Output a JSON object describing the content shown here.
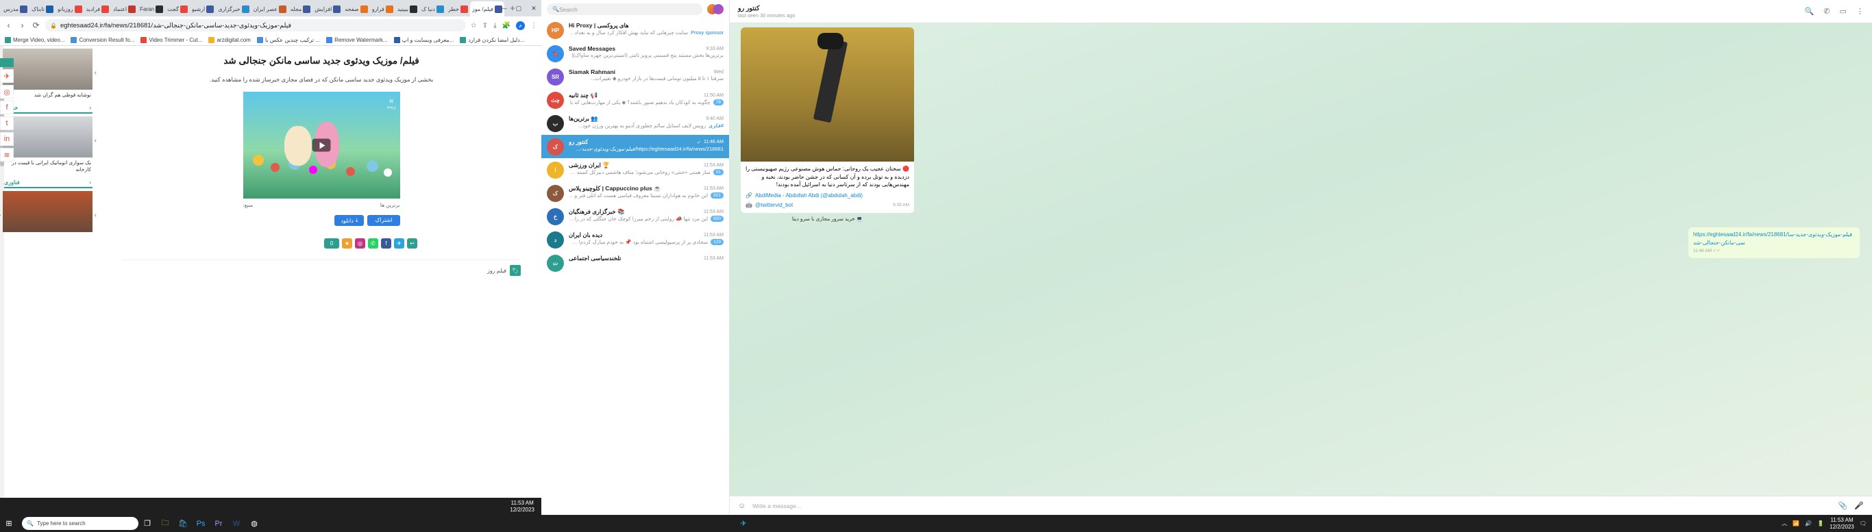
{
  "browser": {
    "tabs": [
      {
        "label": "مدرس",
        "color": "#3d5a9e"
      },
      {
        "label": "تابناک",
        "color": "#1b5fa8"
      },
      {
        "label": "روزیاتو",
        "color": "#e8453c"
      },
      {
        "label": "فرادید",
        "color": "#e8453c"
      },
      {
        "label": "اعتماد",
        "color": "#c0392b"
      },
      {
        "label": "Faran",
        "color": "#2c2c2c"
      },
      {
        "label": "گجت",
        "color": "#e8453c"
      },
      {
        "label": "آرشیو",
        "color": "#3d5a9e"
      },
      {
        "label": "خبرگزاری",
        "color": "#2b8ccc"
      },
      {
        "label": "عصر ایران",
        "color": "#c75b2a"
      },
      {
        "label": "مجله",
        "color": "#3d5a9e"
      },
      {
        "label": "افزایش",
        "color": "#3d5a9e"
      },
      {
        "label": "صفحه",
        "color": "#e8731c"
      },
      {
        "label": "قرارو",
        "color": "#e8731c"
      },
      {
        "label": "ببینید",
        "color": "#2c2c2c"
      },
      {
        "label": "دنیا ک",
        "color": "#2b8ccc"
      },
      {
        "label": "خطر",
        "color": "#e8453c"
      },
      {
        "label": "فیلم/ موز",
        "color": "#3d5a9e",
        "active": true
      }
    ],
    "new_tab_label": "+",
    "window_controls": [
      "—",
      "▢",
      "✕"
    ],
    "url": "eghtesaad24.ir/fa/news/218681/فیلم-موزیک-ویدئوی-جدید-ساسی-مانکن-جنجالی-شد",
    "lock_icon": "lock-icon",
    "nav": {
      "back": "‹",
      "forward": "›",
      "reload": "⟳"
    },
    "omni_icons": [
      "bookmark-star-icon",
      "share-icon",
      "download-icon",
      "extension-icon",
      "menu-icon"
    ],
    "profile_initial": "م",
    "bookmarks": [
      {
        "label": "Merge Video, video...",
        "color": "#2e9e8f"
      },
      {
        "label": "Conversion Result fo...",
        "color": "#4a90d9"
      },
      {
        "label": "Video Trimmer - Cut...",
        "color": "#e8453c"
      },
      {
        "label": "arzdigital.com",
        "color": "#f0b429"
      },
      {
        "label": "ترکیب چندین عکس با ...",
        "color": "#4a90d9"
      },
      {
        "label": "Remove Watermark...",
        "color": "#4285f4"
      },
      {
        "label": "معرفی وبسایت و اپ...",
        "color": "#2b5fa8"
      },
      {
        "label": "دلیل امضا نکردن قرارد...",
        "color": "#2e9e8f"
      }
    ]
  },
  "article": {
    "title": "فیلم/ موزیک ویدئوی جدید ساسی مانکن جنجالی شد",
    "lead": "بخشی از موزیک ویدئوی جدید ساسی مانکن که در فضای مجازی خبرساز شده را مشاهده کنید.",
    "live_badge": "زنده",
    "source_label": "منبع:",
    "source_links": "برترین ها",
    "download_label": "دانلود",
    "download_icon": "download-icon",
    "blue_button": "اشتراک",
    "tag_label": "فیلم روز",
    "tag_icon": "tag-icon",
    "share_icons": [
      "reply-icon",
      "telegram-icon",
      "facebook-icon",
      "whatsapp-icon",
      "instagram-icon",
      "bookmark-icon",
      "comment-icon"
    ],
    "comment_count": "0",
    "rail_icons": [
      "telegram-icon",
      "instagram-icon",
      "facebook-icon",
      "twitter-icon",
      "linkedin-icon",
      "rss-icon"
    ]
  },
  "news_sidebar": [
    {
      "caption": "نوشابه قوطی هم گران شد",
      "img": "cans",
      "arrow": "‹"
    },
    {
      "section": "خودرو",
      "caption": "یک سواری اتوماتیک ایرانی با قیمت در کارخانه",
      "img": "car",
      "arrow": "‹"
    },
    {
      "section": "فناوری",
      "caption": "",
      "img": "protest",
      "arrow": "‹"
    }
  ],
  "telegram": {
    "search_placeholder": "Search",
    "search_icon": "search-icon",
    "chats": [
      {
        "name": "Hi Proxy | های پروکسی",
        "time": "",
        "msg": "سایت چیزهایی که نباید بهش افکار کرد سال و به تعداد سایت مانع تولید و ملیت",
        "sub": "Proxy sponsor",
        "av_color": "#e8853c",
        "av_text": "HP"
      },
      {
        "name": "Saved Messages",
        "time": "9:33 AM",
        "msg": "برترین‌ها بخش مستند پنج قسمتی پرویز ثابتی (امنیتی‌ترین چهره ساواک)|",
        "av_color": "#3390ec",
        "av_text": "🔖",
        "icon": "saved-messages-icon"
      },
      {
        "name": "Siamak Rahmani",
        "time": "Wed",
        "msg": "سرفنا ۱ تا ۵ میلیون تومانی قیمت‌ها در بازار خودرو ◆ تغییرات...",
        "av_color": "#7c5ad6",
        "av_text": "SR"
      },
      {
        "name": "چند ثانیه 📢",
        "time": "11:50 AM",
        "msg": "چگونه به کودکان یاد بدهیم صبور باشند؟ ◆ یکی از مهارت‌هایی که با",
        "av_color": "#e0493c",
        "av_text": "چث",
        "badge": "78"
      },
      {
        "name": "برترین‌ها 👥",
        "time": "9:40 AM",
        "msg": "رویس لایف استایل سالم چطوری آدمو به بهترین ورژن خود...",
        "av_color": "#2b2b2b",
        "av_text": "ب",
        "sub": "#فکری"
      },
      {
        "name": "کنتور رو",
        "time": "11:46 AM",
        "msg": "https://eghtesaad24.ir/fa/news/218681/فیلم-موزیک-ویدئوی-جدید-...",
        "av_color": "#d8534a",
        "av_text": "ک",
        "selected": true,
        "check": "✓"
      },
      {
        "name": "ایران ورزشی 🏆",
        "time": "11:53 AM",
        "msg": "ساز همتی «خنثی» روحانی می‌شود؛ مناف هاشمی دبیرکل کمیته ملی 🔺 یک",
        "av_color": "#f0b429",
        "av_text": "ا",
        "badge": "31"
      },
      {
        "name": "کلوچینو پلاس | Cappuccino plus ☕",
        "time": "11:53 AM",
        "msg": "این خانوم به هواداران نسبتا معروف قیاسی هست که اتلی فنز و بوزین",
        "av_color": "#8b5a3c",
        "av_text": "ک",
        "badge": "501"
      },
      {
        "name": "خبرگزاری فرهنگیان 📚",
        "time": "11:53 AM",
        "msg": "این مرد تنها 📣 روایتی از زخم میرزا کوچک خان جنگلی که در را 💥",
        "av_color": "#2b6fb8",
        "av_text": "خ",
        "badge": "650"
      },
      {
        "name": "دیده بان ایران",
        "time": "11:53 AM",
        "msg": "سجادی پر از پرسپولیسی اشتباه بود 📌 به خودم مبارک کردم! ساختار",
        "av_color": "#1b7a8c",
        "av_text": "د",
        "badge": "123"
      },
      {
        "name": "تلخندسیاسی اجتماعی",
        "time": "11:53 AM",
        "msg": "",
        "av_color": "#2e9e8f",
        "av_text": "ت"
      }
    ],
    "conversation": {
      "title": "کنتور رو",
      "subtitle": "last seen 30 minutes ago",
      "header_icons": [
        "search-icon",
        "phone-icon",
        "video-icon",
        "more-vert-icon"
      ],
      "messages": [
        {
          "type": "in",
          "has_video": true,
          "text": "🔴 سخنان عجیب یک روحانی: حماس هوش مصنوعی رژیم صهیونیستی را دزدیده و به توتل برده و آن کسانی که در جشن حاضر بودند، نخبه و مهندس‌هایی بودند که از سرتاسر دنیا به اسرائیل آمده بودند!",
          "link1": "AbdiMedia - Abdollah Abdi (@abdolah_abdi)",
          "link2": "@twittervid_bot",
          "time": "9:39 AM",
          "footer": "💻 خرید سرور مجازی با سرو دیتا"
        },
        {
          "type": "out",
          "text": "https://eghtesaad24.ir/fa/news/218681/فیلم-موزیک-ویدئوی-جدید-ساسی-مانکن-جنجالی-شد",
          "time": "11:46 AM",
          "check": "✓✓"
        }
      ]
    },
    "compose_placeholder": "Write a message...",
    "compose_icons": [
      "emoji-icon",
      "attach-icon",
      "mic-icon"
    ]
  },
  "taskbar": {
    "start_icon": "windows-start-icon",
    "search_placeholder": "Type here to search",
    "search_icon": "search-icon",
    "pinned": [
      "task-view-icon",
      "folder-icon",
      "store-icon",
      "photoshop-icon",
      "premiere-icon",
      "word-icon",
      "chrome-icon"
    ],
    "running": [
      "telegram-icon"
    ],
    "tray": [
      "arrow-up-icon",
      "network-icon",
      "volume-icon",
      "battery-icon"
    ],
    "clock_time": "11:53 AM",
    "clock_date": "12/2/2023",
    "chrome_clock_time": "11:53 AM",
    "chrome_clock_date": "12/2/2023",
    "notification_icon": "notification-icon"
  }
}
